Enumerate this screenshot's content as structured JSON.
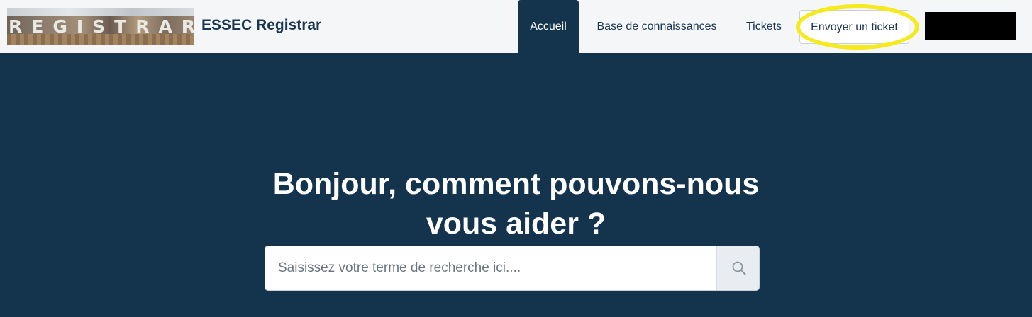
{
  "header": {
    "logo_text": "REGISTRAR",
    "site_name": "ESSEC Registrar",
    "nav": {
      "home": "Accueil",
      "knowledge_base": "Base de connaissances",
      "tickets": "Tickets"
    },
    "submit_ticket": "Envoyer un ticket",
    "highlight_color": "#f4ea1e"
  },
  "hero": {
    "title_line1": "Bonjour, comment pouvons-nous",
    "title_line2": "vous aider ?",
    "background_color": "#14344e"
  },
  "search": {
    "placeholder": "Saisissez votre terme de recherche ici....",
    "value": "",
    "button_icon": "search-icon"
  }
}
